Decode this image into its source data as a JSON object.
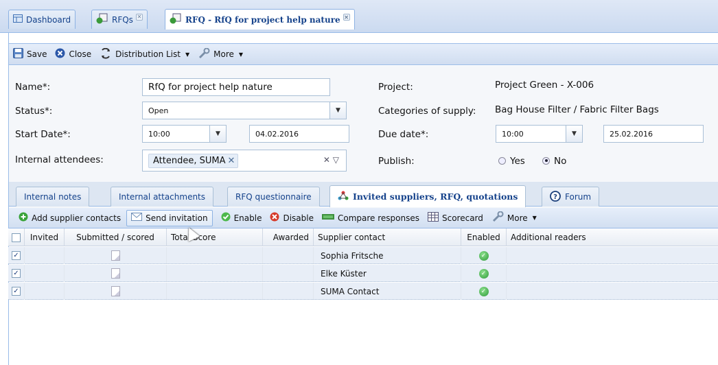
{
  "top_tabs": [
    {
      "label": "Dashboard",
      "icon": "dashboard-icon"
    },
    {
      "label": "RFQs",
      "icon": "rfq-icon"
    },
    {
      "label": "RFQ - RfQ for project help nature",
      "icon": "rfq-icon"
    }
  ],
  "toolbar": {
    "save": "Save",
    "close": "Close",
    "distribution": "Distribution List",
    "more": "More"
  },
  "form": {
    "name_label": "Name*:",
    "name_value": "RfQ for project help nature",
    "status_label": "Status*:",
    "status_value": "Open",
    "start_label": "Start Date*:",
    "start_time": "10:00",
    "start_date": "04.02.2016",
    "attendees_label": "Internal attendees:",
    "attendee_chip": "Attendee, SUMA",
    "project_label": "Project:",
    "project_value": "Project Green - X-006",
    "categories_label": "Categories of supply:",
    "categories_value": "Bag House Filter / Fabric Filter Bags",
    "due_label": "Due date*:",
    "due_time": "10:00",
    "due_date": "25.02.2016",
    "publish_label": "Publish:",
    "publish_yes": "Yes",
    "publish_no": "No"
  },
  "sub_tabs": [
    {
      "label": "Internal notes"
    },
    {
      "label": "Internal attachments"
    },
    {
      "label": "RFQ questionnaire"
    },
    {
      "label": "Invited suppliers, RFQ, quotations"
    },
    {
      "label": "Forum"
    }
  ],
  "grid_toolbar": {
    "add": "Add supplier contacts",
    "send": "Send invitation",
    "enable": "Enable",
    "disable": "Disable",
    "compare": "Compare responses",
    "scorecard": "Scorecard",
    "more": "More"
  },
  "grid": {
    "columns": [
      "Invited",
      "Submitted / scored",
      "Total Score",
      "Awarded",
      "Supplier contact",
      "Enabled",
      "Additional readers"
    ],
    "rows": [
      {
        "contact": "Sophia Fritsche"
      },
      {
        "contact": "Elke Küster"
      },
      {
        "contact": "SUMA Contact"
      }
    ]
  },
  "colors": {
    "accent": "#15428b",
    "border": "#99bbe8",
    "row": "#e8eef7"
  }
}
